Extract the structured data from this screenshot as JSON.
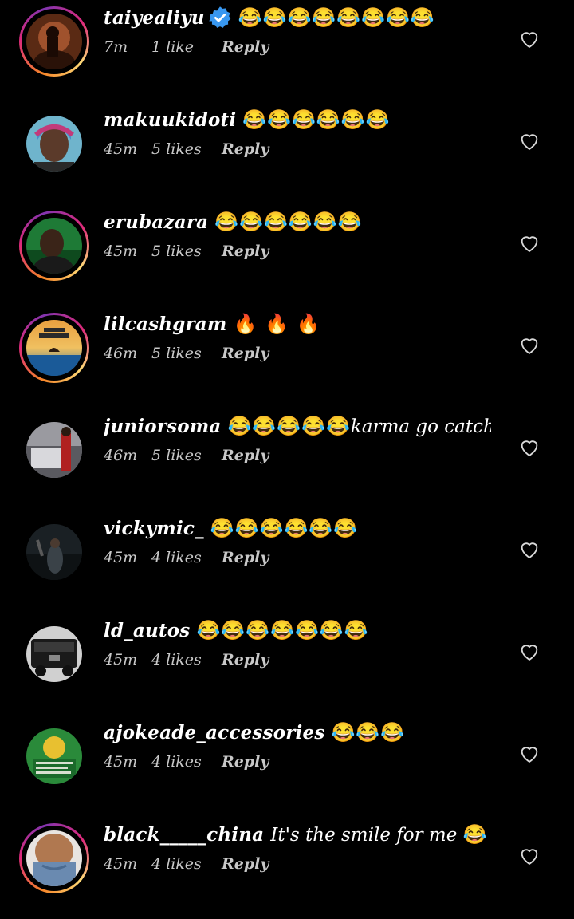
{
  "comments": [
    {
      "username": "taiyealiyu",
      "verified": true,
      "text": "",
      "emoji": "😂😂😂😂😂😂😂😂",
      "time": "7m",
      "likes": "1 like",
      "reply": "Reply",
      "story": true
    },
    {
      "username": "makuukidoti",
      "verified": false,
      "text": "",
      "emoji": "😂😂😂😂😂😂",
      "time": "45m",
      "likes": "5 likes",
      "reply": "Reply",
      "story": false
    },
    {
      "username": "erubazara",
      "verified": false,
      "text": "",
      "emoji": "😂😂😂😂😂😂",
      "time": "45m",
      "likes": "5 likes",
      "reply": "Reply",
      "story": true
    },
    {
      "username": "lilcashgram",
      "verified": false,
      "text": "",
      "emoji": "🔥 🔥 🔥",
      "time": "46m",
      "likes": "5 likes",
      "reply": "Reply",
      "story": true
    },
    {
      "username": "juniorsoma",
      "verified": false,
      "text": "karma go catch am",
      "emoji": "😂😂😂😂😂",
      "time": "46m",
      "likes": "5 likes",
      "reply": "Reply",
      "story": false
    },
    {
      "username": "vickymic_",
      "verified": false,
      "text": "",
      "emoji": "😂😂😂😂😂😂",
      "time": "45m",
      "likes": "4 likes",
      "reply": "Reply",
      "story": false
    },
    {
      "username": "ld_autos",
      "verified": false,
      "text": "",
      "emoji": "😂😂😂😂😂😂😂",
      "time": "45m",
      "likes": "4 likes",
      "reply": "Reply",
      "story": false
    },
    {
      "username": "ajokeade_accessories",
      "verified": false,
      "text": "",
      "emoji": "😂😂😂",
      "time": "45m",
      "likes": "4 likes",
      "reply": "Reply",
      "story": false
    },
    {
      "username": "black_____china",
      "verified": false,
      "text": "It's the smile for me",
      "emoji": "😂",
      "time": "45m",
      "likes": "4 likes",
      "reply": "Reply",
      "story": true
    }
  ],
  "colors": {
    "background": "#000000",
    "text": "#ffffff",
    "meta": "#c8c8c8",
    "verified": "#3897f0"
  }
}
